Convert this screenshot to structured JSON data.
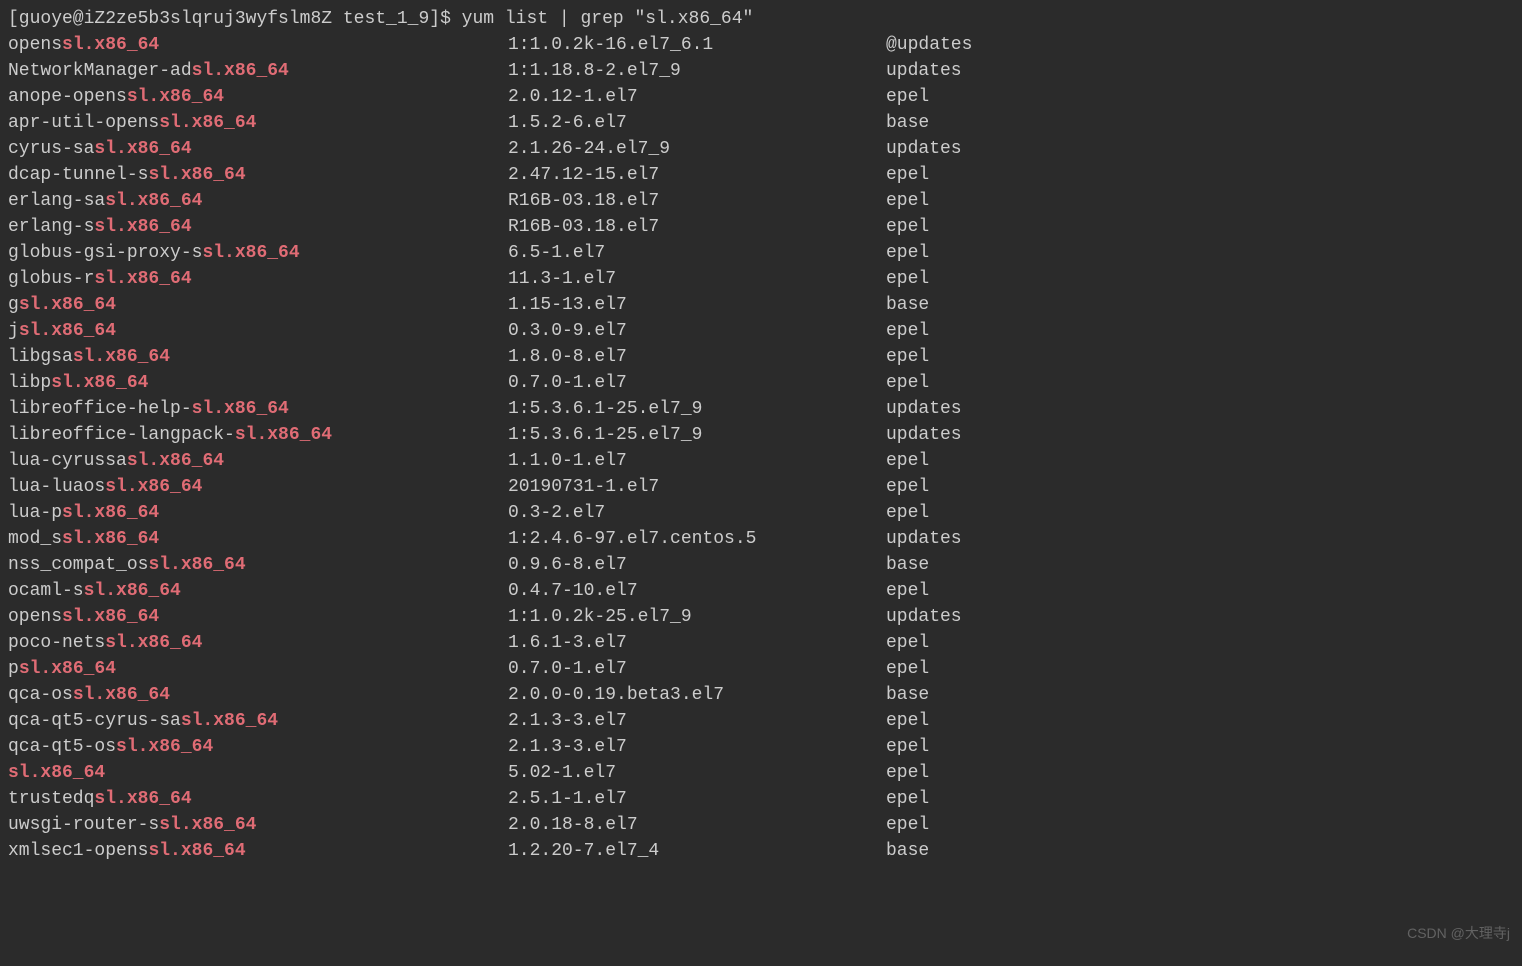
{
  "prompt": {
    "user_host": "[guoye@iZ2ze5b3slqruj3wyfslm8Z test_1_9]$",
    "command": " yum list | grep \"sl.x86_64\""
  },
  "highlight": "sl.x86_64",
  "packages": [
    {
      "prefix": "opens",
      "match": "sl.x86_64",
      "version": "1:1.0.2k-16.el7_6.1",
      "repo": "@updates"
    },
    {
      "prefix": "NetworkManager-ad",
      "match": "sl.x86_64",
      "version": "1:1.18.8-2.el7_9",
      "repo": "updates"
    },
    {
      "prefix": "anope-opens",
      "match": "sl.x86_64",
      "version": "2.0.12-1.el7",
      "repo": "epel"
    },
    {
      "prefix": "apr-util-opens",
      "match": "sl.x86_64",
      "version": "1.5.2-6.el7",
      "repo": "base"
    },
    {
      "prefix": "cyrus-sa",
      "match": "sl.x86_64",
      "version": "2.1.26-24.el7_9",
      "repo": "updates"
    },
    {
      "prefix": "dcap-tunnel-s",
      "match": "sl.x86_64",
      "version": "2.47.12-15.el7",
      "repo": "epel"
    },
    {
      "prefix": "erlang-sa",
      "match": "sl.x86_64",
      "version": "R16B-03.18.el7",
      "repo": "epel"
    },
    {
      "prefix": "erlang-s",
      "match": "sl.x86_64",
      "version": "R16B-03.18.el7",
      "repo": "epel"
    },
    {
      "prefix": "globus-gsi-proxy-s",
      "match": "sl.x86_64",
      "version": "6.5-1.el7",
      "repo": "epel"
    },
    {
      "prefix": "globus-r",
      "match": "sl.x86_64",
      "version": "11.3-1.el7",
      "repo": "epel"
    },
    {
      "prefix": "g",
      "match": "sl.x86_64",
      "version": "1.15-13.el7",
      "repo": "base"
    },
    {
      "prefix": "j",
      "match": "sl.x86_64",
      "version": "0.3.0-9.el7",
      "repo": "epel"
    },
    {
      "prefix": "libgsa",
      "match": "sl.x86_64",
      "version": "1.8.0-8.el7",
      "repo": "epel"
    },
    {
      "prefix": "libp",
      "match": "sl.x86_64",
      "version": "0.7.0-1.el7",
      "repo": "epel"
    },
    {
      "prefix": "libreoffice-help-",
      "match": "sl.x86_64",
      "version": "1:5.3.6.1-25.el7_9",
      "repo": "updates"
    },
    {
      "prefix": "libreoffice-langpack-",
      "match": "sl.x86_64",
      "version": "1:5.3.6.1-25.el7_9",
      "repo": "updates"
    },
    {
      "prefix": "lua-cyrussa",
      "match": "sl.x86_64",
      "version": "1.1.0-1.el7",
      "repo": "epel"
    },
    {
      "prefix": "lua-luaos",
      "match": "sl.x86_64",
      "version": "20190731-1.el7",
      "repo": "epel"
    },
    {
      "prefix": "lua-p",
      "match": "sl.x86_64",
      "version": "0.3-2.el7",
      "repo": "epel"
    },
    {
      "prefix": "mod_s",
      "match": "sl.x86_64",
      "version": "1:2.4.6-97.el7.centos.5",
      "repo": "updates"
    },
    {
      "prefix": "nss_compat_os",
      "match": "sl.x86_64",
      "version": "0.9.6-8.el7",
      "repo": "base"
    },
    {
      "prefix": "ocaml-s",
      "match": "sl.x86_64",
      "version": "0.4.7-10.el7",
      "repo": "epel"
    },
    {
      "prefix": "opens",
      "match": "sl.x86_64",
      "version": "1:1.0.2k-25.el7_9",
      "repo": "updates"
    },
    {
      "prefix": "poco-nets",
      "match": "sl.x86_64",
      "version": "1.6.1-3.el7",
      "repo": "epel"
    },
    {
      "prefix": "p",
      "match": "sl.x86_64",
      "version": "0.7.0-1.el7",
      "repo": "epel"
    },
    {
      "prefix": "qca-os",
      "match": "sl.x86_64",
      "version": "2.0.0-0.19.beta3.el7",
      "repo": "base"
    },
    {
      "prefix": "qca-qt5-cyrus-sa",
      "match": "sl.x86_64",
      "version": "2.1.3-3.el7",
      "repo": "epel"
    },
    {
      "prefix": "qca-qt5-os",
      "match": "sl.x86_64",
      "version": "2.1.3-3.el7",
      "repo": "epel"
    },
    {
      "prefix": "",
      "match": "sl.x86_64",
      "version": "5.02-1.el7",
      "repo": "epel"
    },
    {
      "prefix": "trustedq",
      "match": "sl.x86_64",
      "version": "2.5.1-1.el7",
      "repo": "epel"
    },
    {
      "prefix": "uwsgi-router-s",
      "match": "sl.x86_64",
      "version": "2.0.18-8.el7",
      "repo": "epel"
    },
    {
      "prefix": "xmlsec1-opens",
      "match": "sl.x86_64",
      "version": "1.2.20-7.el7_4",
      "repo": "base"
    }
  ],
  "watermark": "CSDN @大理寺j"
}
